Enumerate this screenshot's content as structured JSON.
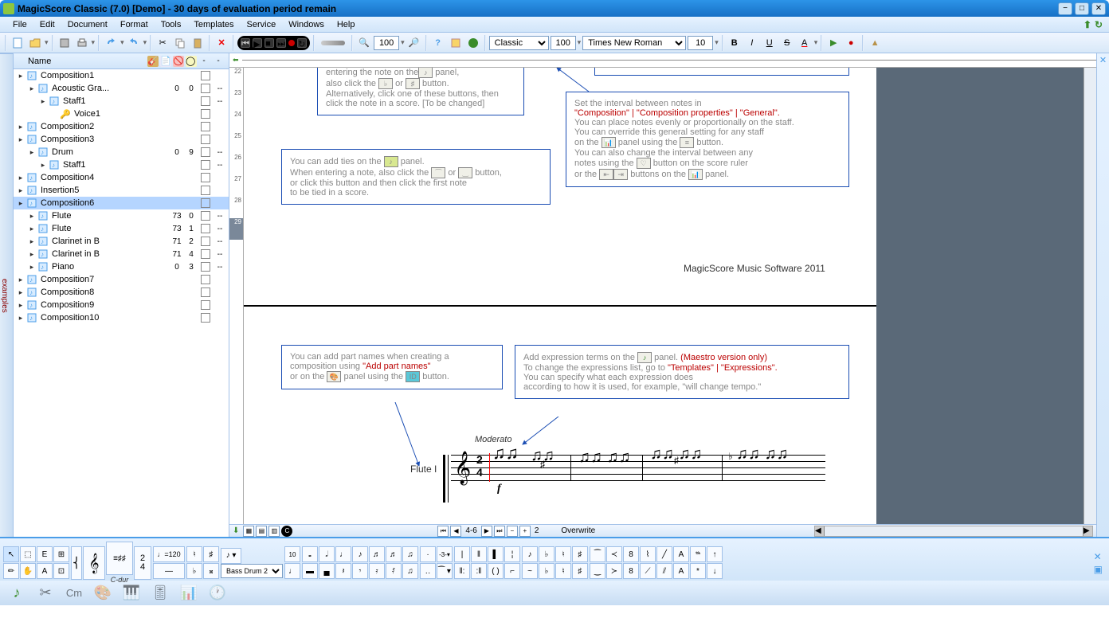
{
  "title": "MagicScore Classic (7.0) [Demo] - 30 days of evaluation period remain",
  "menu": [
    "File",
    "Edit",
    "Document",
    "Format",
    "Tools",
    "Templates",
    "Service",
    "Windows",
    "Help"
  ],
  "toolbar": {
    "zoom": "100",
    "style": "Classic",
    "fontSize": "100",
    "fontName": "Times New Roman",
    "textSize": "10"
  },
  "tree": {
    "header": "Name",
    "rows": [
      {
        "indent": 0,
        "exp": "▸",
        "name": "Composition1",
        "c1": "",
        "c2": "",
        "chk": true,
        "sel": false
      },
      {
        "indent": 1,
        "exp": "▸",
        "name": "Acoustic Gra...",
        "c1": "0",
        "c2": "0",
        "chk": true,
        "sel": false,
        "dash": "--"
      },
      {
        "indent": 2,
        "exp": "▸",
        "name": "Staff1",
        "c1": "",
        "c2": "",
        "chk": true,
        "sel": false,
        "dash": "--"
      },
      {
        "indent": 3,
        "exp": "",
        "name": "Voice1",
        "c1": "",
        "c2": "",
        "chk": true,
        "sel": false,
        "dash": "",
        "key": true
      },
      {
        "indent": 0,
        "exp": "▸",
        "name": "Composition2",
        "c1": "",
        "c2": "",
        "chk": false,
        "sel": false
      },
      {
        "indent": 0,
        "exp": "▸",
        "name": "Composition3",
        "c1": "",
        "c2": "",
        "chk": false,
        "sel": false
      },
      {
        "indent": 1,
        "exp": "▸",
        "name": "Drum",
        "c1": "0",
        "c2": "9",
        "chk": true,
        "sel": false,
        "dash": "--"
      },
      {
        "indent": 2,
        "exp": "▸",
        "name": "Staff1",
        "c1": "",
        "c2": "",
        "chk": false,
        "sel": false,
        "dash": "--"
      },
      {
        "indent": 0,
        "exp": "▸",
        "name": "Composition4",
        "c1": "",
        "c2": "",
        "chk": false,
        "sel": false
      },
      {
        "indent": 0,
        "exp": "▸",
        "name": "Insertion5",
        "c1": "",
        "c2": "",
        "chk": false,
        "sel": false
      },
      {
        "indent": 0,
        "exp": "▸",
        "name": "Composition6",
        "c1": "",
        "c2": "",
        "chk": false,
        "sel": true
      },
      {
        "indent": 1,
        "exp": "▸",
        "name": "Flute",
        "c1": "73",
        "c2": "0",
        "chk": true,
        "sel": false,
        "dash": "--"
      },
      {
        "indent": 1,
        "exp": "▸",
        "name": "Flute",
        "c1": "73",
        "c2": "1",
        "chk": true,
        "sel": false,
        "dash": "--"
      },
      {
        "indent": 1,
        "exp": "▸",
        "name": "Clarinet in B",
        "c1": "71",
        "c2": "2",
        "chk": true,
        "sel": false,
        "dash": "--"
      },
      {
        "indent": 1,
        "exp": "▸",
        "name": "Clarinet in B",
        "c1": "71",
        "c2": "4",
        "chk": true,
        "sel": false,
        "dash": "--"
      },
      {
        "indent": 1,
        "exp": "▸",
        "name": "Piano",
        "c1": "0",
        "c2": "3",
        "chk": true,
        "sel": false,
        "dash": "--"
      },
      {
        "indent": 0,
        "exp": "▸",
        "name": "Composition7",
        "c1": "",
        "c2": "",
        "chk": false,
        "sel": false
      },
      {
        "indent": 0,
        "exp": "▸",
        "name": "Composition8",
        "c1": "",
        "c2": "",
        "chk": false,
        "sel": false
      },
      {
        "indent": 0,
        "exp": "▸",
        "name": "Composition9",
        "c1": "",
        "c2": "",
        "chk": false,
        "sel": false
      },
      {
        "indent": 0,
        "exp": "▸",
        "name": "Composition10",
        "c1": "",
        "c2": "",
        "chk": false,
        "sel": false
      }
    ]
  },
  "examplesTab": "examples",
  "rulerV": [
    22,
    23,
    24,
    25,
    26,
    27,
    28,
    29
  ],
  "rulerVSel": 29,
  "infoBox1": {
    "line1": "entering the note on the",
    "line1b": " panel,",
    "line2a": "also click the ",
    "line2b": " or ",
    "line2c": " button.",
    "line3": "Alternatively, click one of these buttons, then",
    "line4": "click the note in a score. [To be changed]"
  },
  "infoBox2": {
    "line1a": "You can add ties on the ",
    "line1b": " panel.",
    "line2a": "When entering a note, also click the ",
    "line2b": " or ",
    "line2c": " button,",
    "line3": "or click this button and then click the first note",
    "line4": "to be tied in a score."
  },
  "infoBox3": {
    "line1": "Set the interval between notes in",
    "line2": "\"Composition\" | \"Composition properties\" | \"General\".",
    "line3": "You can place notes evenly or proportionally on the staff.",
    "line4": "You can override this general setting for any staff",
    "line5a": "on the ",
    "line5b": " panel using the ",
    "line5c": " button.",
    "line6": "You can also change the interval between any",
    "line7a": "notes using the ",
    "line7b": " button on the score ruler",
    "line8a": "or the ",
    "line8b": " buttons on the ",
    "line8c": " panel."
  },
  "copyright": "MagicScore Music Software 2011",
  "infoBox4": {
    "line1": "You can add part names when creating a",
    "line2a": "composition using ",
    "line2b": "\"Add part names\"",
    "line3a": "or on the ",
    "line3b": " panel using the ",
    "line3c": " button."
  },
  "infoBox5": {
    "line1a": "Add expression terms on the ",
    "line1b": " panel.   ",
    "line1c": "(Maestro version only)",
    "line2a": "To change the expressions list, go to  ",
    "line2b": "\"Templates\" | \"Expressions\".",
    "line3": "You can specify what each expression does",
    "line4": "according to how it is used, for example, \"will change tempo.\""
  },
  "score": {
    "tempo": "Moderato",
    "part": "Flute I",
    "timeSig": "2 4",
    "dynamic": "f"
  },
  "status": {
    "pages": "4-6",
    "pageNum": "2",
    "mode": "Overwrite"
  },
  "bottomBar": {
    "cdur": "C-dur",
    "tempo120": "120",
    "drum": "Bass Drum 2"
  }
}
